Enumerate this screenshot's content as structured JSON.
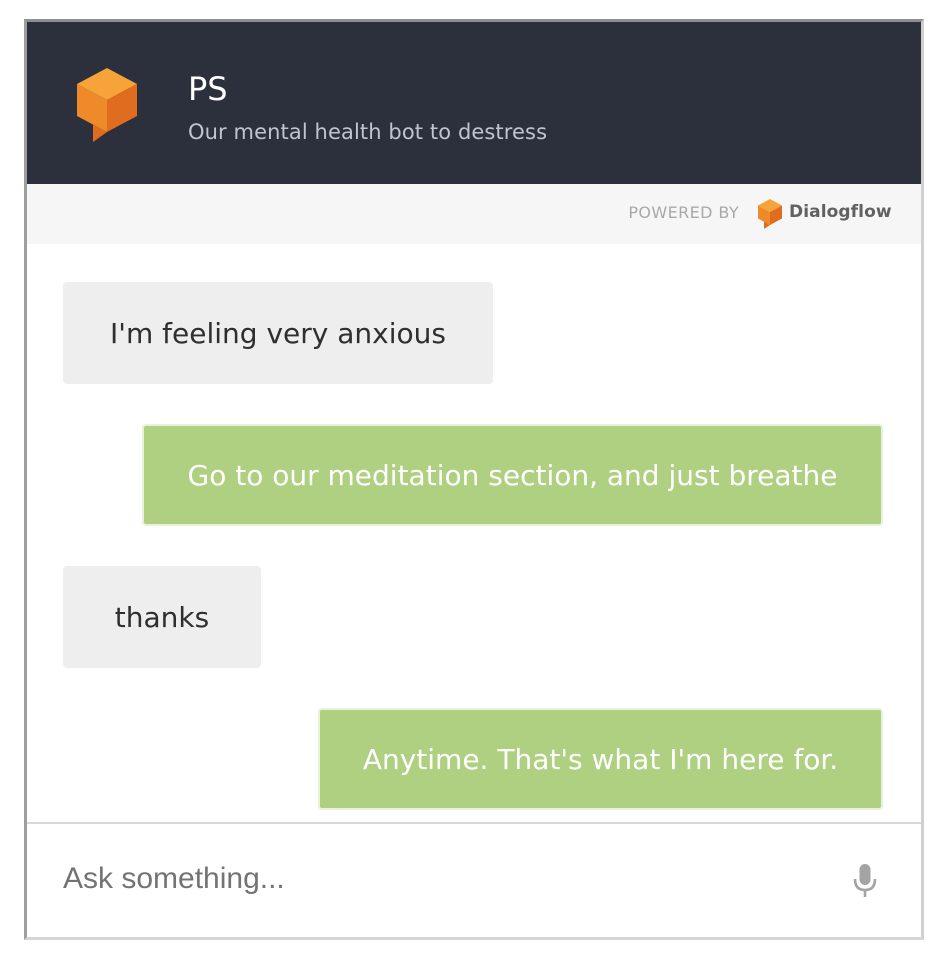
{
  "header": {
    "agent_name": "PS",
    "agent_description": "Our mental health bot to destress",
    "background_color": "#2c303d",
    "logo_icon": "dialogflow-cube-speech-icon"
  },
  "powered_by": {
    "label": "POWERED BY",
    "brand": "Dialogflow",
    "brand_icon": "dialogflow-logo-icon"
  },
  "conversation": {
    "messages": [
      {
        "role": "user",
        "text": "I'm feeling very anxious"
      },
      {
        "role": "bot",
        "text": "Go to our meditation section, and just breathe"
      },
      {
        "role": "user",
        "text": "thanks"
      },
      {
        "role": "bot",
        "text": "Anytime. That's what I'm here for."
      }
    ],
    "user_bubble_color": "#eeeeee",
    "bot_bubble_color": "#aed080"
  },
  "input": {
    "placeholder": "Ask something...",
    "value": "",
    "mic_icon": "microphone-icon"
  },
  "colors": {
    "accent_orange": "#ef8e2f",
    "accent_orange_dark": "#e06d1f"
  }
}
